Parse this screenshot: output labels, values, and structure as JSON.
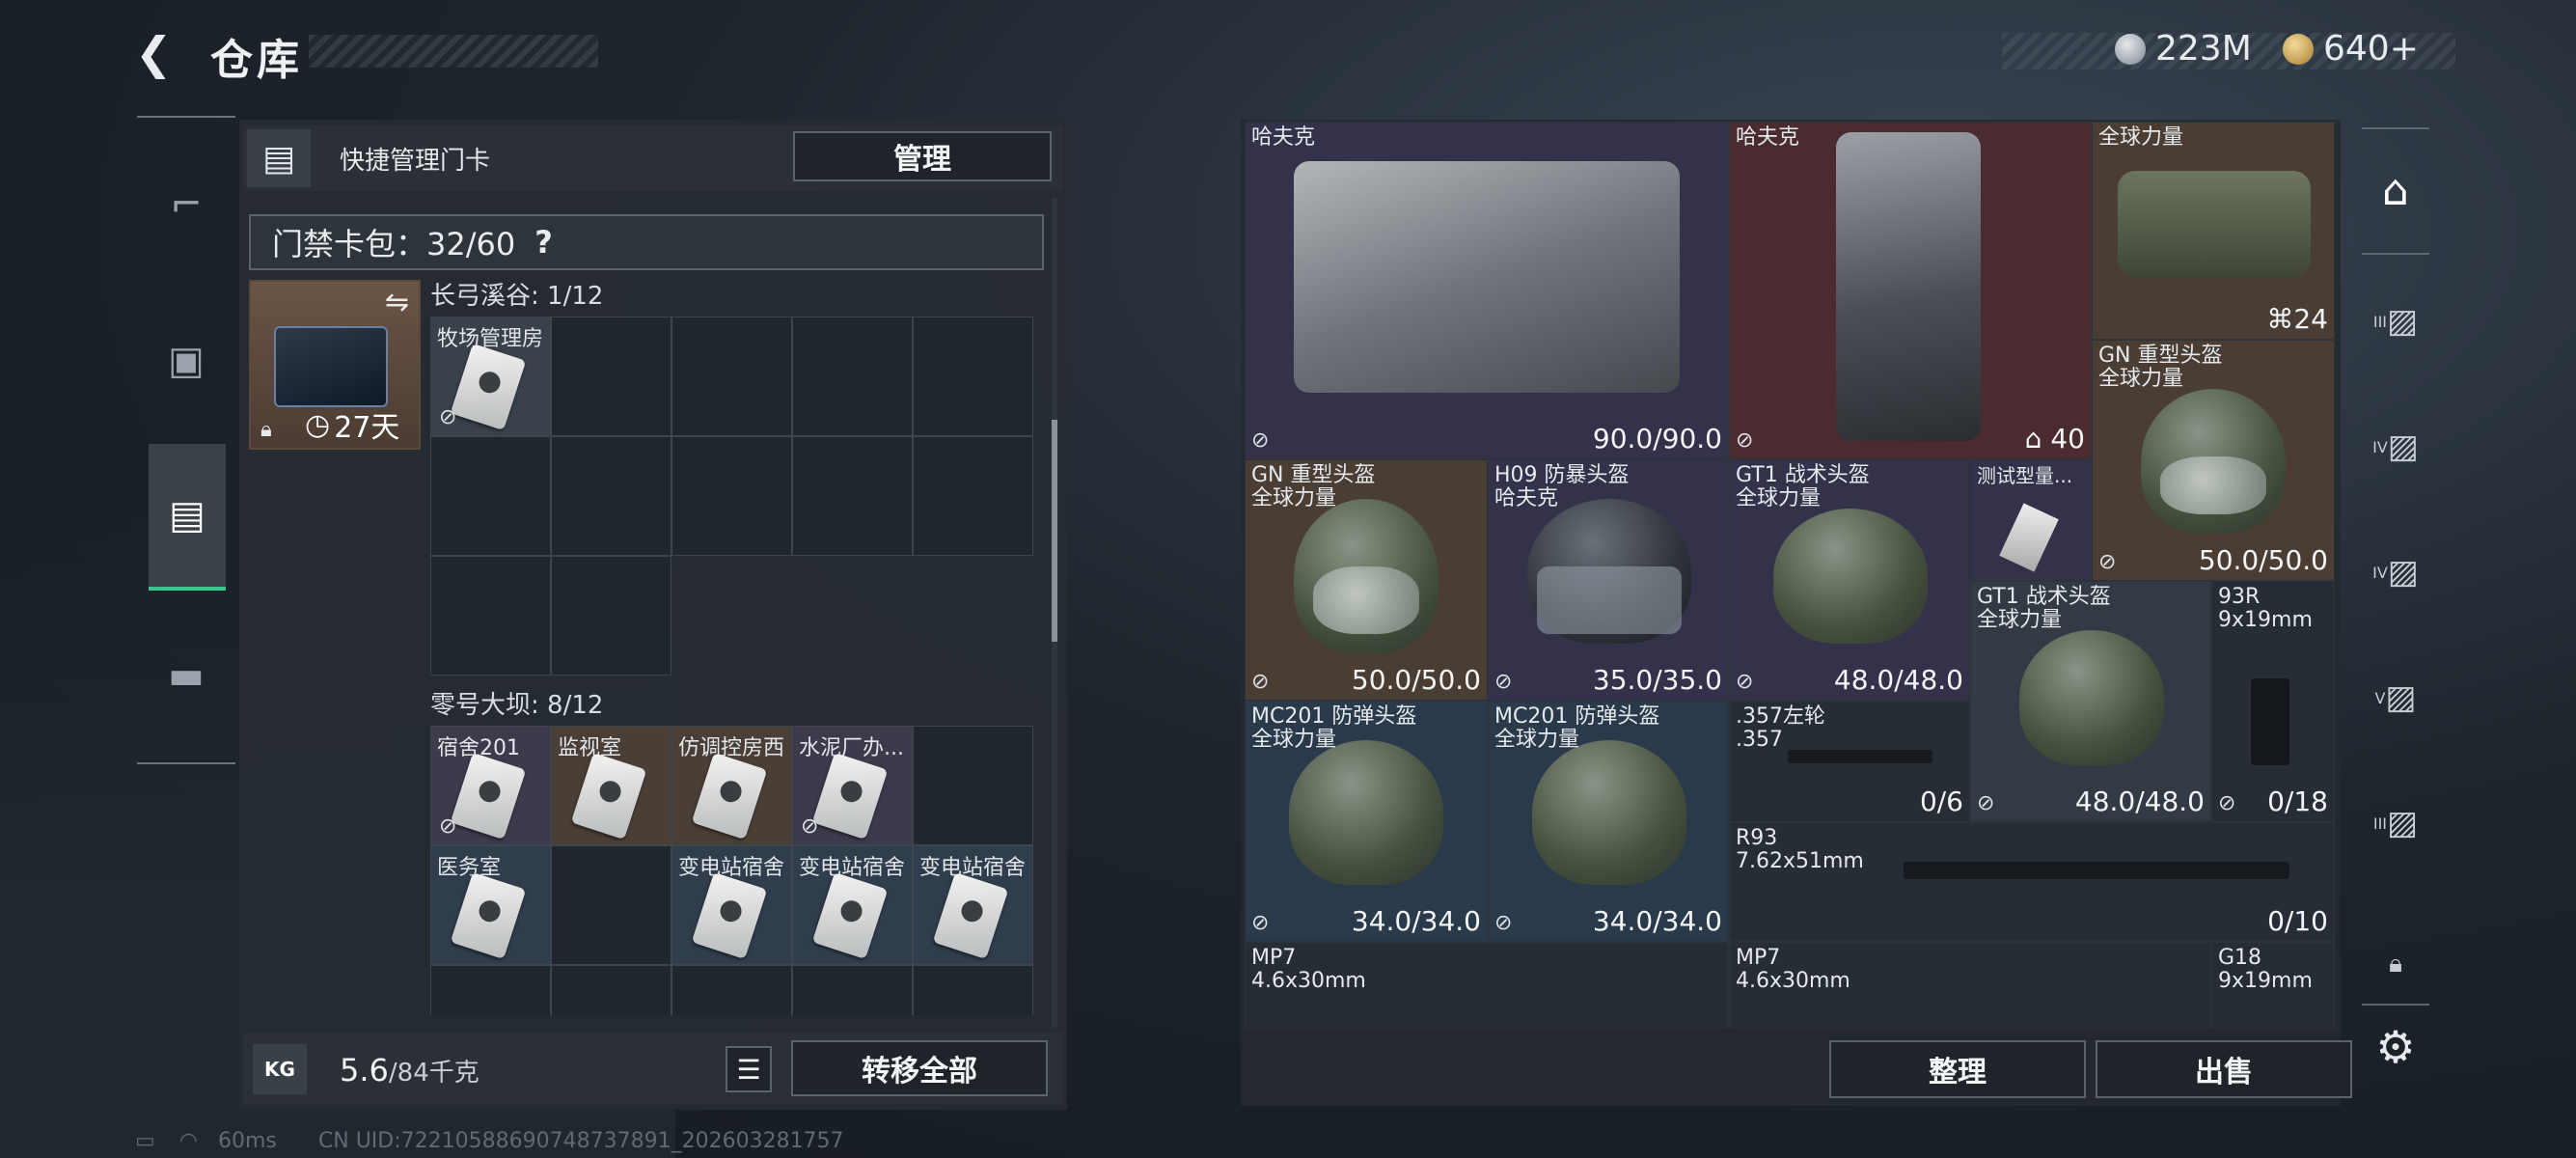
{
  "header": {
    "back_icon": "back-arrow-icon",
    "title": "仓库",
    "currencies": [
      {
        "icon": "silver-coin-icon",
        "color": "#9aa4ad",
        "value": "223M"
      },
      {
        "icon": "gold-coin-icon",
        "color": "#d9b25a",
        "value": "640+"
      }
    ]
  },
  "left_nav": {
    "items": [
      {
        "name": "weapon",
        "icon": "pistol-icon",
        "glyph": "╤"
      },
      {
        "name": "equipment",
        "icon": "vest-icon",
        "glyph": "▣"
      },
      {
        "name": "keycard-bag",
        "icon": "keycard-bag-icon",
        "glyph": "▤",
        "active": true
      },
      {
        "name": "supplies",
        "icon": "toolbox-icon",
        "glyph": "▬"
      }
    ]
  },
  "keycard_panel": {
    "header_label": "快捷管理门卡",
    "manage_button": "管理",
    "bag_label": "门禁卡包：32/60",
    "help": "?",
    "selected_card": {
      "days": "27天"
    },
    "sections": [
      {
        "title": "长弓溪谷: 1/12",
        "cards": [
          {
            "name": "牧场管理房",
            "color": "on"
          }
        ]
      },
      {
        "title": "零号大坝: 8/12",
        "cards": [
          {
            "name": "宿舍201",
            "color": "purple"
          },
          {
            "name": "监视室",
            "color": "brown"
          },
          {
            "name": "仿调控房西",
            "color": "brown"
          },
          {
            "name": "水泥厂办...",
            "color": "purple"
          },
          {
            "name": "",
            "color": "empty"
          },
          {
            "name": "医务室",
            "color": "blue"
          },
          {
            "name": "",
            "color": "empty"
          },
          {
            "name": "变电站宿舍",
            "color": "blue"
          },
          {
            "name": "变电站宿舍",
            "color": "blue"
          },
          {
            "name": "变电站宿舍",
            "color": "blue"
          }
        ]
      }
    ],
    "weight": "5.6",
    "weight_max": "/84千克",
    "transfer_button": "转移全部"
  },
  "storage": {
    "items": [
      {
        "name": "哈夫克",
        "durability": "90.0/90.0"
      },
      {
        "name": "哈夫克",
        "durability": "40"
      },
      {
        "name": "全球力量",
        "durability": "24"
      },
      {
        "name": "GN 重型头盔\n全球力量",
        "durability": "50.0/50.0"
      },
      {
        "name": "GN 重型头盔\n全球力量",
        "durability": "50.0/50.0"
      },
      {
        "name": "H09 防暴头盔\n哈夫克",
        "durability": "35.0/35.0"
      },
      {
        "name": "GT1 战术头盔\n全球力量",
        "durability": "48.0/48.0"
      },
      {
        "name": "测试型量...",
        "durability": ""
      },
      {
        "name": "GT1 战术头盔\n全球力量",
        "durability": "48.0/48.0"
      },
      {
        "name": "93R\n9x19mm",
        "durability": "0/18"
      },
      {
        "name": "MC201 防弹头盔\n全球力量",
        "durability": "34.0/34.0"
      },
      {
        "name": "MC201 防弹头盔\n全球力量",
        "durability": "34.0/34.0"
      },
      {
        "name": ".357左轮\n.357",
        "durability": "0/6"
      },
      {
        "name": "R93\n7.62x51mm",
        "durability": "0/10"
      },
      {
        "name": "MP7\n4.6x30mm",
        "durability": ""
      },
      {
        "name": "MP7\n4.6x30mm",
        "durability": ""
      },
      {
        "name": "G18\n9x19mm",
        "durability": ""
      }
    ],
    "sort_button": "整理",
    "sell_button": "出售"
  },
  "right_nav": {
    "items": [
      {
        "icon": "main-storage-icon",
        "label": ""
      },
      {
        "icon": "storage-expansion-icon",
        "label": "III"
      },
      {
        "icon": "storage-expansion-icon",
        "label": "IV"
      },
      {
        "icon": "storage-expansion-icon",
        "label": "IV"
      },
      {
        "icon": "storage-expansion-icon",
        "label": "V"
      },
      {
        "icon": "storage-expansion-icon",
        "label": "III"
      },
      {
        "icon": "lock-icon",
        "label": ""
      }
    ],
    "settings_icon": "gear-icon"
  },
  "status_bar": {
    "ping": "60ms",
    "uid": "CN UID:7221058869074873789​1_202603281757"
  }
}
